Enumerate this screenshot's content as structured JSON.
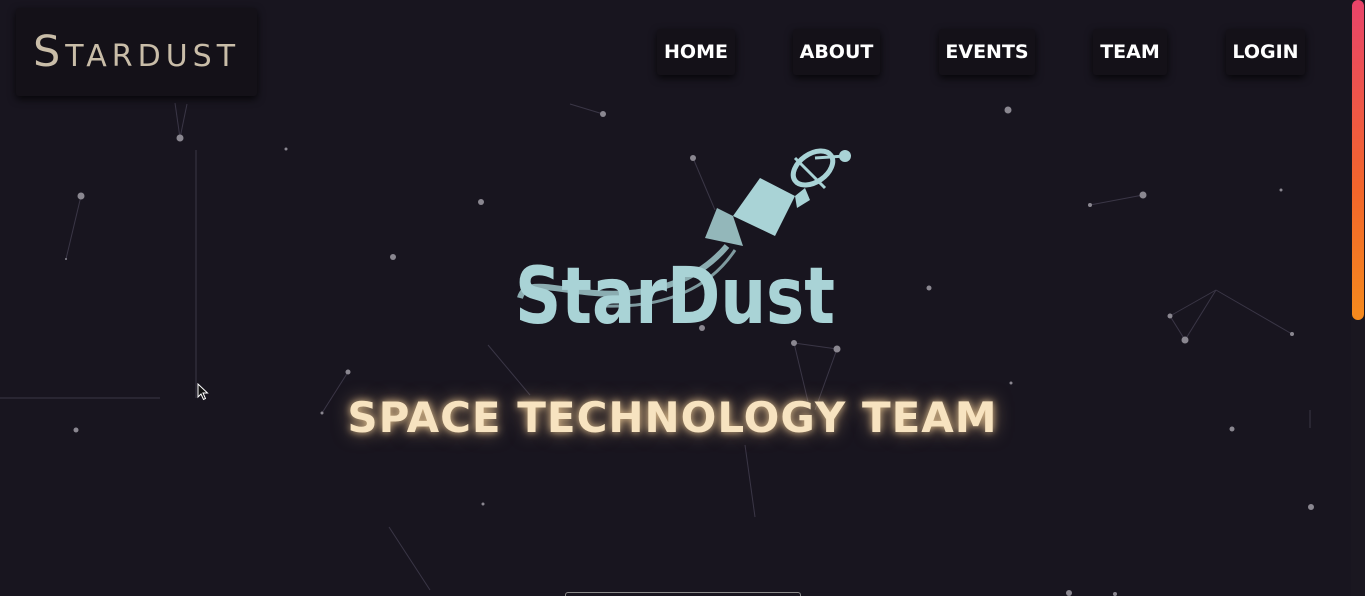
{
  "brand": {
    "title": "Stardust"
  },
  "nav": {
    "items": [
      "HOME",
      "ABOUT",
      "EVENTS",
      "TEAM",
      "LOGIN"
    ]
  },
  "hero": {
    "logo_text": "StarDust",
    "tagline": "SPACE TECHNOLOGY TEAM"
  },
  "colors": {
    "background": "#18151f",
    "brand_text": "#c9bda8",
    "logo": "#a9d3d6",
    "tagline": "#f7e3c0",
    "nav_bg": "#141118",
    "nav_text": "#ffffff",
    "scroll_thumb": "#e8446a"
  },
  "icons": {
    "logo": "rocket-logo-icon",
    "cursor": "mouse-cursor-icon"
  }
}
